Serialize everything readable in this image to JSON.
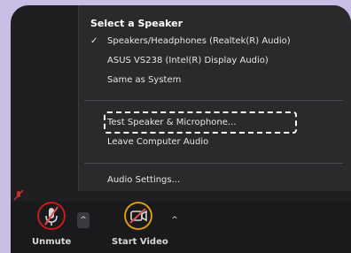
{
  "menu": {
    "heading": "Select a Speaker",
    "speakers": [
      {
        "label": "Speakers/Headphones (Realtek(R) Audio)",
        "selected": true
      },
      {
        "label": "ASUS VS238 (Intel(R) Display Audio)",
        "selected": false
      },
      {
        "label": "Same as System",
        "selected": false
      }
    ],
    "check_mark": "✓",
    "test_label": "Test Speaker & Microphone...",
    "leave_label": "Leave Computer Audio",
    "settings_label": "Audio Settings..."
  },
  "toolbar": {
    "unmute_label": "Unmute",
    "start_video_label": "Start Video",
    "caret_symbol": "^"
  },
  "colors": {
    "annotation_red": "#d11a1a",
    "annotation_gold": "#e0a000",
    "muted_icon_red": "#e05050"
  },
  "icons": [
    "mic-muted-icon",
    "video-off-icon",
    "chevron-up-icon",
    "check-icon"
  ]
}
